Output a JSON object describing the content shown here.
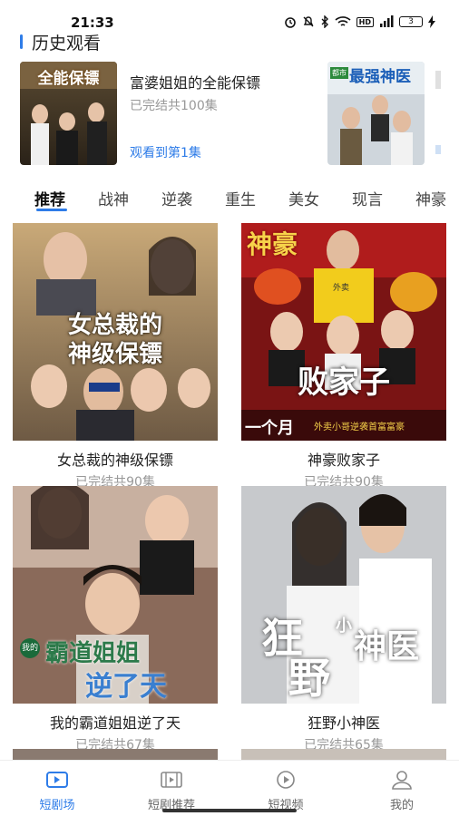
{
  "status_bar": {
    "time": "21:33",
    "battery": "3",
    "hd": "HD",
    "icons": [
      "alarm-icon",
      "mute-icon",
      "bluetooth-icon",
      "wifi-icon",
      "hd-icon",
      "signal-5g-icon",
      "battery-icon",
      "charging-icon"
    ]
  },
  "history": {
    "title": "历史观看",
    "card": {
      "poster_text": "全能保镖",
      "title": "富婆姐姐的全能保镖",
      "status": "已完结共100集",
      "progress": "观看到第1集"
    },
    "next_poster_text": "最强神医",
    "next_poster_tag": "都市"
  },
  "tabs": [
    "推荐",
    "战神",
    "逆袭",
    "重生",
    "美女",
    "现言",
    "神豪"
  ],
  "active_tab": "推荐",
  "grid": [
    {
      "title": "女总裁的神级保镖",
      "status": "已完结共90集",
      "poster_line1": "女总裁的",
      "poster_line2": "神级保镖"
    },
    {
      "title": "神豪败家子",
      "status": "已完结共90集",
      "poster_top": "神豪",
      "poster_main": "败家子",
      "poster_bottom_left": "一个月",
      "poster_bottom_right": "外卖小哥逆袭首富富豪",
      "poster_vest": "外卖"
    },
    {
      "title": "我的霸道姐姐逆了天",
      "status": "已完结共67集",
      "poster_small": "我的",
      "poster_line1": "霸道姐姐",
      "poster_line2": "逆了天"
    },
    {
      "title": "狂野小神医",
      "status": "已完结共65集",
      "poster_line1": "狂",
      "poster_line2": "小",
      "poster_line3": "野",
      "poster_line4": "神医"
    }
  ],
  "bottom_nav": [
    {
      "label": "短剧场",
      "icon": "video-player-icon",
      "active": true
    },
    {
      "label": "短剧推荐",
      "icon": "film-icon",
      "active": false
    },
    {
      "label": "短视频",
      "icon": "play-circle-icon",
      "active": false
    },
    {
      "label": "我的",
      "icon": "profile-icon",
      "active": false
    }
  ],
  "colors": {
    "accent": "#2e7ce8",
    "muted": "#999999"
  }
}
